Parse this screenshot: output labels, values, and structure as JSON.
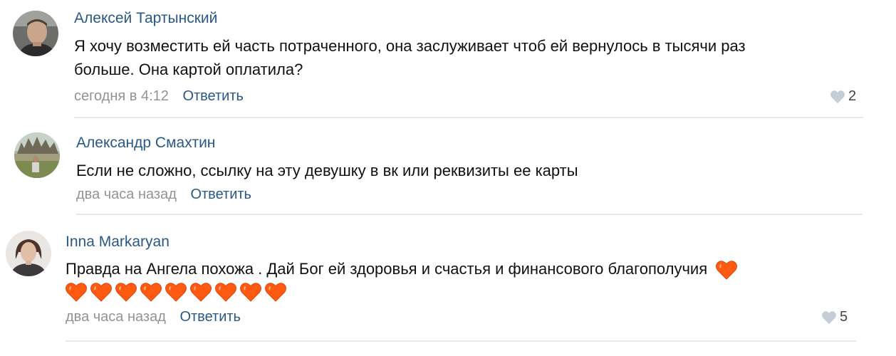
{
  "comments": [
    {
      "author": "Алексей Тартынский",
      "text_line1": "Я хочу возместить ей часть потраченного, она заслуживает чтоб ей вернулось в тысячи раз",
      "text_line2": "больше. Она картой оплатила?",
      "time": "сегодня в 4:12",
      "reply": "Ответить",
      "likes": "2"
    },
    {
      "author": "Александр Смахтин",
      "text_line1": "Если не сложно, ссылку на эту девушку в вк или реквизиты ее карты",
      "time": "два часа назад",
      "reply": "Ответить"
    },
    {
      "author": "Inna Markaryan",
      "text_line1": "Правда на Ангела похожа . Дай Бог ей здоровья и счастья и финансового благополучия",
      "emoji_count": 9,
      "time": "два часа назад",
      "reply": "Ответить",
      "likes": "5"
    }
  ],
  "icons": {
    "like": "heart-icon",
    "emoji": "orange-heart-emoji"
  },
  "colors": {
    "link": "#2a5885",
    "meta": "#939393",
    "heart_emoji": "#ff5a12",
    "like_heart": "#c5cdd6"
  }
}
